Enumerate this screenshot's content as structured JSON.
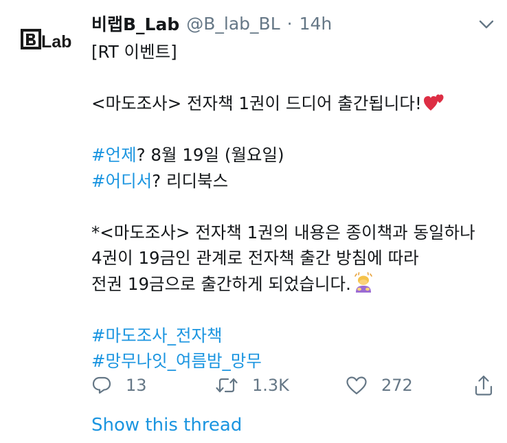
{
  "account": {
    "logo_text": "BLab",
    "display_name": "비랩B_Lab",
    "handle": "@B_lab_BL",
    "separator": "·",
    "time": "14h"
  },
  "tweet": {
    "line1": "[RT 이벤트]",
    "line2": "<마도조사> 전자책 1권이 드디어 출간됩니다!",
    "line3_tag": "#언제",
    "line3_rest": "? 8월 19일 (월요일)",
    "line4_tag": "#어디서",
    "line4_rest": "? 리디북스",
    "line5": "*<마도조사> 전자책 1권의 내용은 종이책과 동일하나",
    "line6": "4권이 19금인 관계로 전자책 출간 방침에 따라",
    "line7": "전권 19금으로 출간하게 되었습니다.",
    "tag1": "#마도조사_전자책",
    "tag2": "#망무나잇_여름밤_망무"
  },
  "actions": {
    "reply_count": "13",
    "retweet_count": "1.3K",
    "like_count": "272"
  },
  "show_thread": "Show this thread",
  "colors": {
    "link": "#1b95e0",
    "text": "#14171a",
    "muted": "#657786"
  },
  "icons": [
    "blab-logo",
    "chevron-down-icon",
    "two-hearts-emoji",
    "person-bowing-emoji",
    "reply-icon",
    "retweet-icon",
    "like-icon",
    "share-icon"
  ]
}
